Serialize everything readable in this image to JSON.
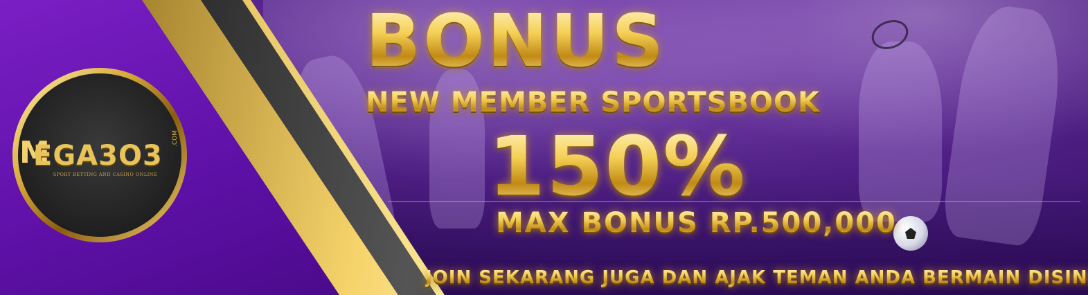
{
  "logo": {
    "brand": "EGA3O3",
    "mark": "M",
    "domain_suffix": ".COM",
    "tagline": "SPORT BETTING AND CASINO ONLINE"
  },
  "promo": {
    "title": "BONUS",
    "subtitle": "NEW MEMBER SPORTSBOOK",
    "percentage": "150%",
    "max_bonus": "MAX BONUS RP.500,000",
    "call_to_action": "JOIN SEKARANG JUGA DAN  AJAK TEMAN ANDA BERMAIN DISINI"
  },
  "colors": {
    "background_purple": "#5d10a6",
    "gold": "#f5cf55",
    "dark_stripe": "#222222"
  }
}
